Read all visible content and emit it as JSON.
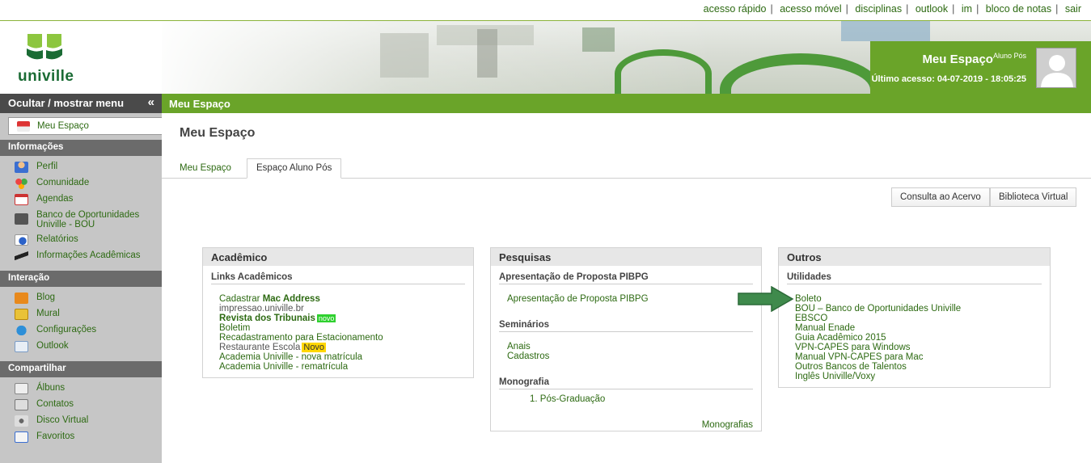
{
  "toplinks": [
    "acesso rápido",
    "acesso móvel",
    "disciplinas",
    "outlook",
    "im",
    "bloco de notas",
    "sair"
  ],
  "logo": {
    "text": "univille"
  },
  "user": {
    "title": "Meu Espaço",
    "title_sup": "Aluno Pós",
    "last_access": "Último acesso: 04-07-2019 - 18:05:25"
  },
  "breadcrumb": "Meu Espaço",
  "sidebar": {
    "toggle_label": "Ocultar / mostrar menu",
    "toggle_icon": "«",
    "current": "Meu Espaço",
    "sections": [
      {
        "title": "Informações",
        "items": [
          "Perfil",
          "Comunidade",
          "Agendas",
          "Banco de Oportunidades Univille - BOU",
          "Relatórios",
          "Informações Acadêmicas"
        ]
      },
      {
        "title": "Interação",
        "items": [
          "Blog",
          "Mural",
          "Configurações",
          "Outlook"
        ]
      },
      {
        "title": "Compartilhar",
        "items": [
          "Álbuns",
          "Contatos",
          "Disco Virtual",
          "Favoritos"
        ]
      }
    ]
  },
  "main": {
    "title": "Meu Espaço",
    "tabs": [
      "Meu Espaço",
      "Espaço Aluno Pós"
    ],
    "buttons": [
      "Consulta ao Acervo",
      "Biblioteca Virtual"
    ]
  },
  "academico": {
    "title": "Acadêmico",
    "subtitle": "Links Acadêmicos",
    "links": [
      {
        "pre": "Cadastrar ",
        "bold": "Mac Address"
      },
      {
        "text": "impressao.univille.br",
        "gray": true
      },
      {
        "bold": "Revista dos Tribunais",
        "badge": "novo"
      },
      {
        "text": "Boletim"
      },
      {
        "text": "Recadastramento para Estacionamento"
      },
      {
        "text": "Restaurante Escola",
        "badge_yellow": "Novo",
        "gray": true
      },
      {
        "text": "Academia Univille - nova matrícula"
      },
      {
        "text": "Academia Univille - rematrícula"
      }
    ]
  },
  "pesquisas": {
    "title": "Pesquisas",
    "section1": "Apresentação de Proposta PIBPG",
    "link1": "Apresentação de Proposta PIBPG",
    "section2": "Seminários",
    "links2": [
      "Anais",
      "Cadastros"
    ],
    "section3": "Monografia",
    "item3": "1. Pós-Graduação",
    "more": "Monografias"
  },
  "outros": {
    "title": "Outros",
    "subtitle": "Utilidades",
    "links": [
      "Boleto",
      "BOU – Banco de Oportunidades Univille",
      "EBSCO",
      "Manual Enade",
      "Guia Acadêmico 2015",
      "VPN-CAPES para Windows",
      "Manual VPN-CAPES para Mac",
      "Outros Bancos de Talentos",
      "Inglês Univille/Voxy"
    ]
  },
  "colors": {
    "green": "#6aa429",
    "link": "#2d6a12",
    "sidebar": "#c6c6c6",
    "arrow": "#3f8a4c"
  }
}
